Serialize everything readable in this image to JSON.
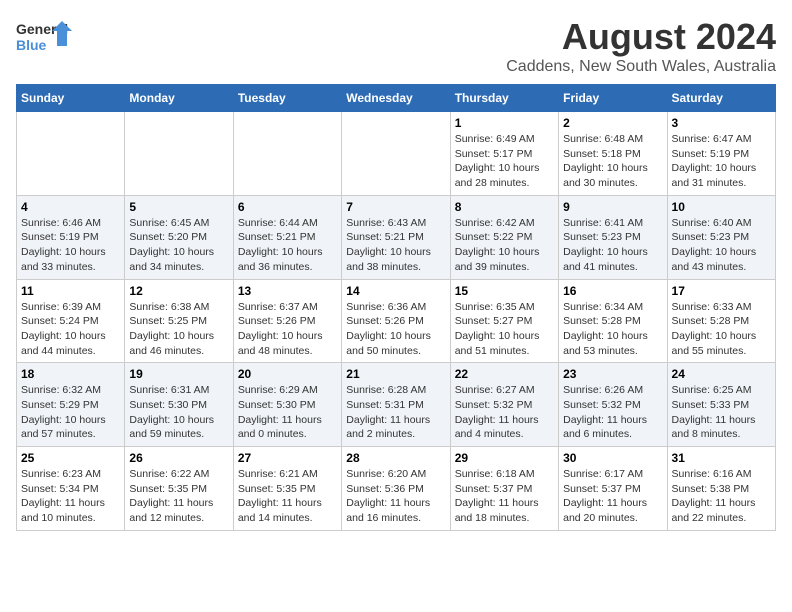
{
  "header": {
    "logo_line1": "General",
    "logo_line2": "Blue",
    "main_title": "August 2024",
    "subtitle": "Caddens, New South Wales, Australia"
  },
  "weekdays": [
    "Sunday",
    "Monday",
    "Tuesday",
    "Wednesday",
    "Thursday",
    "Friday",
    "Saturday"
  ],
  "weeks": [
    [
      {
        "day": "",
        "info": ""
      },
      {
        "day": "",
        "info": ""
      },
      {
        "day": "",
        "info": ""
      },
      {
        "day": "",
        "info": ""
      },
      {
        "day": "1",
        "info": "Sunrise: 6:49 AM\nSunset: 5:17 PM\nDaylight: 10 hours\nand 28 minutes."
      },
      {
        "day": "2",
        "info": "Sunrise: 6:48 AM\nSunset: 5:18 PM\nDaylight: 10 hours\nand 30 minutes."
      },
      {
        "day": "3",
        "info": "Sunrise: 6:47 AM\nSunset: 5:19 PM\nDaylight: 10 hours\nand 31 minutes."
      }
    ],
    [
      {
        "day": "4",
        "info": "Sunrise: 6:46 AM\nSunset: 5:19 PM\nDaylight: 10 hours\nand 33 minutes."
      },
      {
        "day": "5",
        "info": "Sunrise: 6:45 AM\nSunset: 5:20 PM\nDaylight: 10 hours\nand 34 minutes."
      },
      {
        "day": "6",
        "info": "Sunrise: 6:44 AM\nSunset: 5:21 PM\nDaylight: 10 hours\nand 36 minutes."
      },
      {
        "day": "7",
        "info": "Sunrise: 6:43 AM\nSunset: 5:21 PM\nDaylight: 10 hours\nand 38 minutes."
      },
      {
        "day": "8",
        "info": "Sunrise: 6:42 AM\nSunset: 5:22 PM\nDaylight: 10 hours\nand 39 minutes."
      },
      {
        "day": "9",
        "info": "Sunrise: 6:41 AM\nSunset: 5:23 PM\nDaylight: 10 hours\nand 41 minutes."
      },
      {
        "day": "10",
        "info": "Sunrise: 6:40 AM\nSunset: 5:23 PM\nDaylight: 10 hours\nand 43 minutes."
      }
    ],
    [
      {
        "day": "11",
        "info": "Sunrise: 6:39 AM\nSunset: 5:24 PM\nDaylight: 10 hours\nand 44 minutes."
      },
      {
        "day": "12",
        "info": "Sunrise: 6:38 AM\nSunset: 5:25 PM\nDaylight: 10 hours\nand 46 minutes."
      },
      {
        "day": "13",
        "info": "Sunrise: 6:37 AM\nSunset: 5:26 PM\nDaylight: 10 hours\nand 48 minutes."
      },
      {
        "day": "14",
        "info": "Sunrise: 6:36 AM\nSunset: 5:26 PM\nDaylight: 10 hours\nand 50 minutes."
      },
      {
        "day": "15",
        "info": "Sunrise: 6:35 AM\nSunset: 5:27 PM\nDaylight: 10 hours\nand 51 minutes."
      },
      {
        "day": "16",
        "info": "Sunrise: 6:34 AM\nSunset: 5:28 PM\nDaylight: 10 hours\nand 53 minutes."
      },
      {
        "day": "17",
        "info": "Sunrise: 6:33 AM\nSunset: 5:28 PM\nDaylight: 10 hours\nand 55 minutes."
      }
    ],
    [
      {
        "day": "18",
        "info": "Sunrise: 6:32 AM\nSunset: 5:29 PM\nDaylight: 10 hours\nand 57 minutes."
      },
      {
        "day": "19",
        "info": "Sunrise: 6:31 AM\nSunset: 5:30 PM\nDaylight: 10 hours\nand 59 minutes."
      },
      {
        "day": "20",
        "info": "Sunrise: 6:29 AM\nSunset: 5:30 PM\nDaylight: 11 hours\nand 0 minutes."
      },
      {
        "day": "21",
        "info": "Sunrise: 6:28 AM\nSunset: 5:31 PM\nDaylight: 11 hours\nand 2 minutes."
      },
      {
        "day": "22",
        "info": "Sunrise: 6:27 AM\nSunset: 5:32 PM\nDaylight: 11 hours\nand 4 minutes."
      },
      {
        "day": "23",
        "info": "Sunrise: 6:26 AM\nSunset: 5:32 PM\nDaylight: 11 hours\nand 6 minutes."
      },
      {
        "day": "24",
        "info": "Sunrise: 6:25 AM\nSunset: 5:33 PM\nDaylight: 11 hours\nand 8 minutes."
      }
    ],
    [
      {
        "day": "25",
        "info": "Sunrise: 6:23 AM\nSunset: 5:34 PM\nDaylight: 11 hours\nand 10 minutes."
      },
      {
        "day": "26",
        "info": "Sunrise: 6:22 AM\nSunset: 5:35 PM\nDaylight: 11 hours\nand 12 minutes."
      },
      {
        "day": "27",
        "info": "Sunrise: 6:21 AM\nSunset: 5:35 PM\nDaylight: 11 hours\nand 14 minutes."
      },
      {
        "day": "28",
        "info": "Sunrise: 6:20 AM\nSunset: 5:36 PM\nDaylight: 11 hours\nand 16 minutes."
      },
      {
        "day": "29",
        "info": "Sunrise: 6:18 AM\nSunset: 5:37 PM\nDaylight: 11 hours\nand 18 minutes."
      },
      {
        "day": "30",
        "info": "Sunrise: 6:17 AM\nSunset: 5:37 PM\nDaylight: 11 hours\nand 20 minutes."
      },
      {
        "day": "31",
        "info": "Sunrise: 6:16 AM\nSunset: 5:38 PM\nDaylight: 11 hours\nand 22 minutes."
      }
    ]
  ]
}
